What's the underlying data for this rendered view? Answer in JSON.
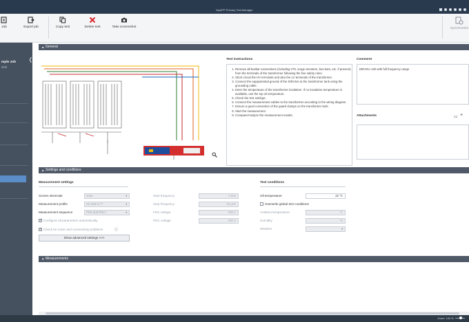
{
  "window": {
    "title": "MyAPP Primary Test Manager"
  },
  "ribbon": {
    "buttons": [
      {
        "label": "Job",
        "icon": "new-job-icon"
      },
      {
        "label": "Export job",
        "icon": "export-job-icon"
      },
      {
        "label": "Copy test",
        "icon": "copy-test-icon"
      },
      {
        "label": "Delete test",
        "icon": "delete-test-icon"
      },
      {
        "label": "Take screenshot",
        "icon": "camera-icon"
      }
    ],
    "sync": {
      "label": "Synchronize",
      "icon": "synchronize-icon"
    }
  },
  "sidebar": {
    "job_title": "mple Job",
    "job_sub": "ntrol"
  },
  "sections": {
    "general": "General",
    "settings": "Settings and conditions",
    "measurements": "Measurements"
  },
  "instructions": {
    "title": "Test instructions",
    "steps": [
      "Remove all busbar connections (including VTs, surge arresters, bus bars, etc. if present) from the terminals of the transformer following the five safety rules.",
      "Short circuit the HV terminals and also the LV terminals of the transformer.",
      "Connect the equipotential ground of the DIRANA to the transformer tank using the grounding cable.",
      "Enter the temperature of the transformer insulation. If no insulation temperature is available, use the top oil temperature.",
      "Check the test settings.",
      "Connect the measurement cables to the transformer according to the wiring diagram.",
      "Ensure a good connection of the guard clamps on the transformer tank.",
      "Start the measurement.",
      "Compare/Analyze the measurement results."
    ]
  },
  "comment": {
    "title": "Comment",
    "text": "DIRANA 100 with full frequency range"
  },
  "attachments": {
    "title": "Attachments"
  },
  "measurement_settings": {
    "title": "Measurement settings",
    "screen_electrode": {
      "label": "Screen electrode",
      "value": "none"
    },
    "measurement_profile": {
      "label": "Measurement profile",
      "value": "HV and LV T"
    },
    "measurement_sequence": {
      "label": "Measurement sequence",
      "value": "PDS and PDC+"
    },
    "configure_all": "Configure all parameters automatically",
    "check_noise": "Check for noise and connectivity problems",
    "show_advanced": "Show advanced settings >>>"
  },
  "frequency_settings": {
    "start_frequency": {
      "label": "Start frequency",
      "value": "1 kHz"
    },
    "stop_frequency": {
      "label": "Stop frequency",
      "value": "10 µHz"
    },
    "fds_voltage": {
      "label": "FDS voltage",
      "value": "200 V"
    },
    "pdc_voltage": {
      "label": "PDC voltage",
      "value": "200 V"
    }
  },
  "test_conditions": {
    "title": "Test conditions",
    "oil_temperature": {
      "label": "Oil temperature",
      "value": "22 °C"
    },
    "overwrite_global": "Overwrite global test conditions",
    "ambient_temperature": {
      "label": "Ambient temperature",
      "unit": "°C"
    },
    "humidity": {
      "label": "Humidity",
      "unit": "%"
    },
    "weather": {
      "label": "Weather"
    }
  },
  "statusbar": {
    "zoom": "Zoom: 100 %"
  },
  "colors": {
    "accent": "#5b8dc8",
    "titlebar": "#2a3a4e",
    "section": "#4f5967",
    "sidebar": "#46515f"
  }
}
